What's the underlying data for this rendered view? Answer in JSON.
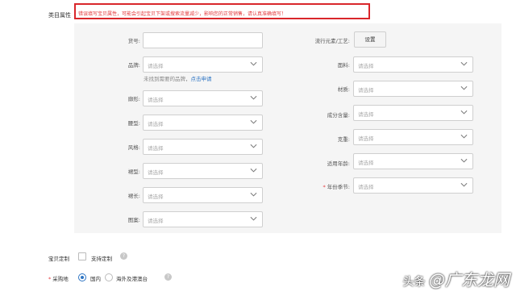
{
  "header": {
    "section_label": "类目属性",
    "warning": "错误填写宝贝属性，可能会引起宝贝下架或搜索流量减少，影响您的正常销售，请认真准确填写！"
  },
  "left_fields": [
    {
      "label": "货号",
      "type": "input",
      "value": ""
    },
    {
      "label": "品牌",
      "type": "select",
      "placeholder": "请选择"
    },
    {
      "label": "廓形",
      "type": "select",
      "placeholder": "请选择"
    },
    {
      "label": "腰型",
      "type": "select",
      "placeholder": "请选择"
    },
    {
      "label": "风格",
      "type": "select",
      "placeholder": "请选择"
    },
    {
      "label": "裙型",
      "type": "select",
      "placeholder": "请选择"
    },
    {
      "label": "裙长",
      "type": "select",
      "placeholder": "请选择"
    },
    {
      "label": "图案",
      "type": "select",
      "placeholder": "请选择"
    }
  ],
  "brand_hint": {
    "text": "未找到需要的品牌，",
    "link": "点击申请"
  },
  "right_fields": [
    {
      "label": "流行元素/工艺",
      "type": "button",
      "button_label": "设置"
    },
    {
      "label": "面料",
      "type": "select",
      "placeholder": "请选择"
    },
    {
      "label": "材质",
      "type": "select",
      "placeholder": "请选择"
    },
    {
      "label": "成分含量",
      "type": "select",
      "placeholder": "请选择"
    },
    {
      "label": "克重",
      "type": "select",
      "placeholder": "请选择"
    },
    {
      "label": "适用年龄",
      "type": "select",
      "placeholder": "请选择"
    },
    {
      "label": "年份季节",
      "type": "select",
      "placeholder": "请选择",
      "required": true
    }
  ],
  "customize": {
    "label": "宝贝定制",
    "checkbox_label": "支持定制",
    "checked": false,
    "help_icon": "?"
  },
  "purchase_place": {
    "label": "采购地",
    "required": true,
    "options": [
      {
        "label": "国内",
        "selected": true
      },
      {
        "label": "海外及港澳台",
        "selected": false
      }
    ],
    "help_icon": "?"
  },
  "watermark": {
    "prefix": "头条",
    "main": "@广东龙网"
  },
  "colors": {
    "warning_border": "#d9262b",
    "warning_text": "#e4393c",
    "link": "#2d74c3",
    "panel_bg": "#f5f5f5"
  },
  "icons": {
    "select_arrow": "chevron-down-icon"
  }
}
